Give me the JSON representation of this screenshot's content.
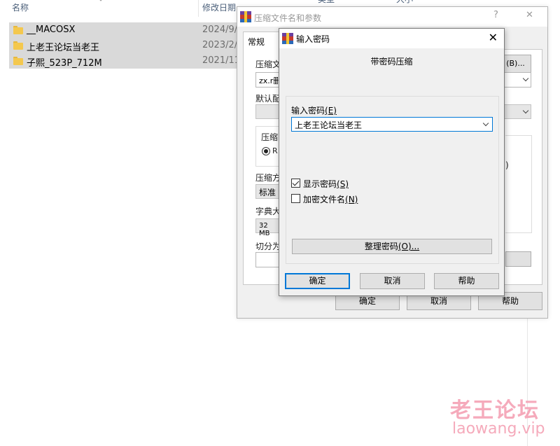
{
  "explorer": {
    "columns": [
      "名称",
      "修改日期",
      "类型",
      "大小"
    ],
    "rows": [
      {
        "name": "__MACOSX",
        "date": "2024/9/"
      },
      {
        "name": "上老王论坛当老王",
        "date": "2023/2/"
      },
      {
        "name": "子熙_523P_712M",
        "date": "2021/11"
      }
    ]
  },
  "back_window": {
    "title": "压缩文件名和参数",
    "help_glyph": "?",
    "close_glyph": "✕",
    "tab": "常规",
    "label_archive_name": "压缩文",
    "archive_name_value": "zx.r删",
    "browse_suffix": "(B)...",
    "label_default_profile": "默认配",
    "label_format": "压缩",
    "radio_prefix": "R",
    "label_method": "压缩方",
    "method_value": "标准",
    "label_dict": "字典大",
    "dict_value": "32 MB",
    "label_split": "切分为",
    "paren_glyph": ")",
    "ok": "确定",
    "cancel": "取消",
    "help": "帮助"
  },
  "dialog": {
    "title": "输入密码",
    "close_glyph": "✕",
    "heading": "带密码压缩",
    "password_label": "输入密码",
    "password_key": "(E)",
    "password_value": "上老王论坛当老王",
    "show_password_label": "显示密码",
    "show_password_key": "(S)",
    "show_password_checked": true,
    "encrypt_names_label": "加密文件名",
    "encrypt_names_key": "(N)",
    "encrypt_names_checked": false,
    "organize_btn": "整理密码",
    "organize_key": "(O)...",
    "ok": "确定",
    "cancel": "取消",
    "help": "帮助"
  },
  "watermark": {
    "title": "老王论坛",
    "url": "laowang.vip"
  },
  "colors": {
    "accent": "#0078d7",
    "watermark": "#f5a1b4",
    "row_selected": "#d9d9d9"
  }
}
